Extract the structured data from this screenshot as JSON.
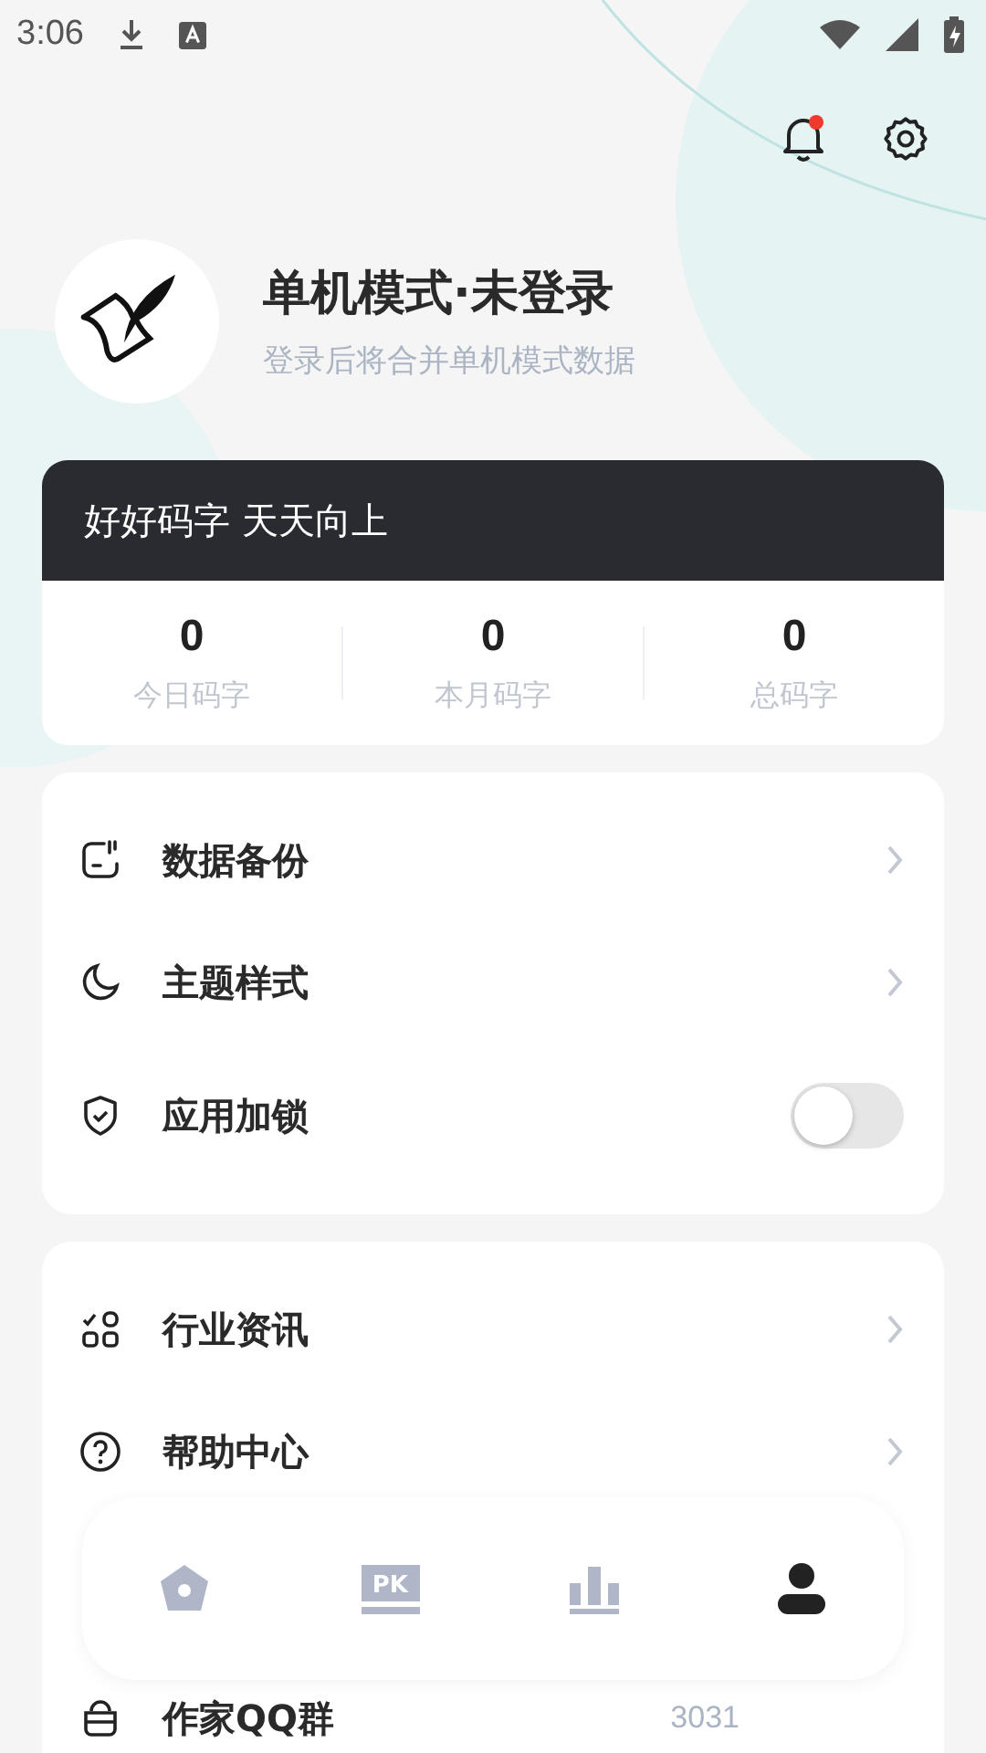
{
  "status_bar": {
    "time": "3:06"
  },
  "header": {
    "has_notification": true
  },
  "profile": {
    "name": "单机模式·未登录",
    "subtitle": "登录后将合并单机模式数据"
  },
  "stats_card": {
    "slogan": "好好码字 天天向上",
    "stats": [
      {
        "value": "0",
        "label": "今日码字"
      },
      {
        "value": "0",
        "label": "本月码字"
      },
      {
        "value": "0",
        "label": "总码字"
      }
    ]
  },
  "menu_sections": [
    {
      "items": [
        {
          "label": "数据备份",
          "kind": "link"
        },
        {
          "label": "主题样式",
          "kind": "link"
        },
        {
          "label": "应用加锁",
          "kind": "toggle",
          "on": false
        }
      ]
    },
    {
      "items": [
        {
          "label": "行业资讯",
          "kind": "link"
        },
        {
          "label": "帮助中心",
          "kind": "link"
        },
        {
          "label": "作家QQ群",
          "kind": "value",
          "value": "3031"
        }
      ]
    }
  ],
  "bottom_nav": [
    {
      "kind": "home",
      "selected": false
    },
    {
      "kind": "pk",
      "text": "PK",
      "selected": false
    },
    {
      "kind": "stats",
      "selected": false
    },
    {
      "kind": "profile",
      "selected": true
    }
  ]
}
